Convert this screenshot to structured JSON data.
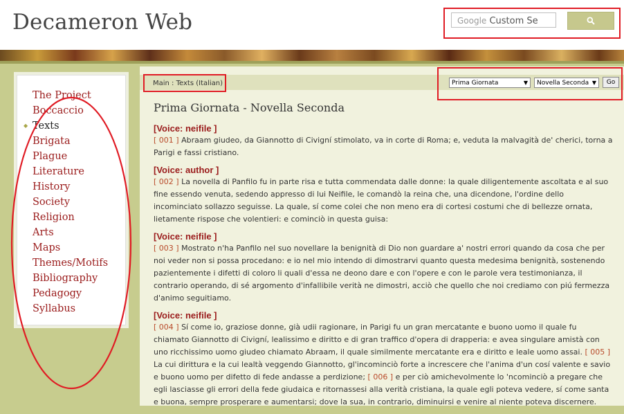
{
  "header": {
    "site_title": "Decameron Web",
    "search_google": "Google",
    "search_placeholder": "Custom Se"
  },
  "breadcrumb": "Main : Texts (Italian)",
  "selectors": {
    "giornata": "Prima Giornata",
    "novella": "Novella Seconda",
    "go_label": "Go"
  },
  "sidebar": {
    "items": [
      {
        "label": "The Project"
      },
      {
        "label": "Boccaccio"
      },
      {
        "label": "Texts"
      },
      {
        "label": "Brigata"
      },
      {
        "label": "Plague"
      },
      {
        "label": "Literature"
      },
      {
        "label": "History"
      },
      {
        "label": "Society"
      },
      {
        "label": "Religion"
      },
      {
        "label": "Arts"
      },
      {
        "label": "Maps"
      },
      {
        "label": "Themes/Motifs"
      },
      {
        "label": "Bibliography"
      },
      {
        "label": "Pedagogy"
      },
      {
        "label": "Syllabus"
      }
    ]
  },
  "main": {
    "title": "Prima Giornata - Novella Seconda",
    "sections": [
      {
        "voice": "[Voice: neifile ]",
        "num": "[ 001 ]",
        "text": " Abraam giudeo, da Giannotto di Civigní stimolato, va in corte di Roma; e, veduta la malvagità de' cherici, torna a Parigi e fassi cristiano."
      },
      {
        "voice": "[Voice: author ]",
        "num": "[ 002 ]",
        "text": " La novella di Panfilo fu in parte risa e tutta commendata dalle donne: la quale diligentemente ascoltata e al suo fine essendo venuta, sedendo appresso di lui Neifile, le comandò la reina che, una dicendone, l'ordine dello incominciato sollazzo seguisse. La quale, sí come colei che non meno era di cortesi costumi che di bellezze ornata, lietamente rispose che volentieri: e cominciò in questa guisa:"
      },
      {
        "voice": "[Voice: neifile ]",
        "num": "[ 003 ]",
        "text": " Mostrato n'ha Panfilo nel suo novellare la benignità di Dio non guardare a' nostri errori quando da cosa che per noi veder non si possa procedano: e io nel mio intendo di dimostrarvi quanto questa medesima benignità, sostenendo pazientemente i difetti di coloro li quali d'essa ne deono dare e con l'opere e con le parole vera testimonianza, il contrario operando, di sé argomento d'infallibile verità ne dimostri, acciò che quello che noi crediamo con piú fermezza d'animo seguitiamo."
      },
      {
        "voice": "[Voice: neifile ]",
        "num": "[ 004 ]",
        "text": " Sí come io, graziose donne, già udii ragionare, in Parigi fu un gran mercatante e buono uomo il quale fu chiamato Giannotto di Civigní, lealissimo e diritto e di gran traffico d'opera di drapperia: e avea singulare amistà con uno ricchissimo uomo giudeo chiamato Abraam, il quale similmente mercatante era e diritto e leale uomo assai. ",
        "num2": "[ 005 ]",
        "text2": " La cui dirittura e la cui lealtà veggendo Giannotto, gl'incominciò forte a increscere che l'anima d'un cosí valente e savio e buono uomo per difetto di fede andasse a perdizione; ",
        "num3": "[ 006 ]",
        "text3": " e per ciò amichevolmente lo 'ncominciò a pregare che egli lasciasse gli errori della fede giudaica e ritornassesi alla verità cristiana, la quale egli poteva vedere, sí come santa e buona, sempre prosperare e aumentarsi; dove la sua, in contrario, diminuirsi e venire al niente poteva discernere."
      }
    ]
  }
}
